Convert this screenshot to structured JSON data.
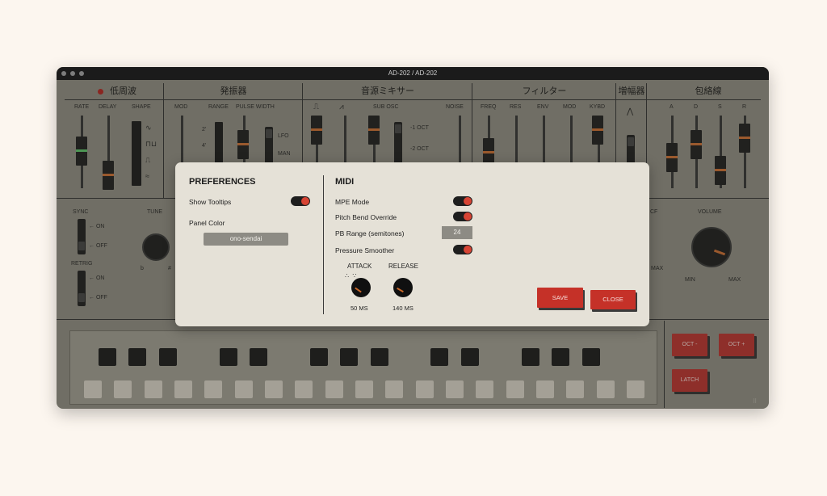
{
  "window": {
    "title": "AD-202 / AD-202"
  },
  "sections": {
    "lfo": {
      "title": "低周波",
      "labels": [
        "RATE",
        "DELAY",
        "SHAPE"
      ]
    },
    "oscillator": {
      "title": "発振器",
      "labels": [
        "MOD",
        "RANGE",
        "PULSE WIDTH"
      ],
      "range_ticks": [
        "2'",
        "4'"
      ],
      "pw_marks": [
        "LFO",
        "MAN"
      ]
    },
    "mixer": {
      "title": "音源ミキサー",
      "labels": [
        "SUB OSC",
        "NOISE"
      ],
      "sub_marks": [
        "-1 OCT",
        "-2 OCT"
      ]
    },
    "filter": {
      "title": "フィルター",
      "labels": [
        "FREQ",
        "RES",
        "ENV",
        "MOD",
        "KYBD"
      ]
    },
    "amp": {
      "title": "増幅器"
    },
    "envelope": {
      "title": "包絡線",
      "labels": [
        "A",
        "D",
        "S",
        "R"
      ]
    },
    "mid": {
      "sync": "SYNC",
      "retrig": "RETRIG",
      "on": "ON",
      "off": "OFF",
      "tune": "TUNE",
      "tune_flat": "b",
      "tune_sharp": "#",
      "vcf_partial": "CF",
      "vcf_max": "MAX",
      "volume": "VOLUME",
      "vol_min": "MIN",
      "vol_max": "MAX"
    }
  },
  "buttons": {
    "oct_down": "OCT -",
    "oct_up": "OCT +",
    "latch": "LATCH"
  },
  "colors": {
    "accent": "#c53128",
    "slider_mark": "#c8682a",
    "led": "#b01c18"
  },
  "preferences": {
    "title": "PREFERENCES",
    "show_tooltips": "Show Tooltips",
    "panel_color_label": "Panel Color",
    "panel_color_value": "ono-sendai"
  },
  "midi": {
    "title": "MIDI",
    "mpe": "MPE Mode",
    "pitch_bend": "Pitch Bend Override",
    "pb_range": "PB Range (semitones)",
    "pb_range_value": "24",
    "pressure": "Pressure Smoother",
    "attack": "ATTACK",
    "attack_value": "50 MS",
    "release": "RELEASE",
    "release_value": "140 MS"
  },
  "modal_buttons": {
    "save": "SAVE",
    "close": "CLOSE"
  }
}
